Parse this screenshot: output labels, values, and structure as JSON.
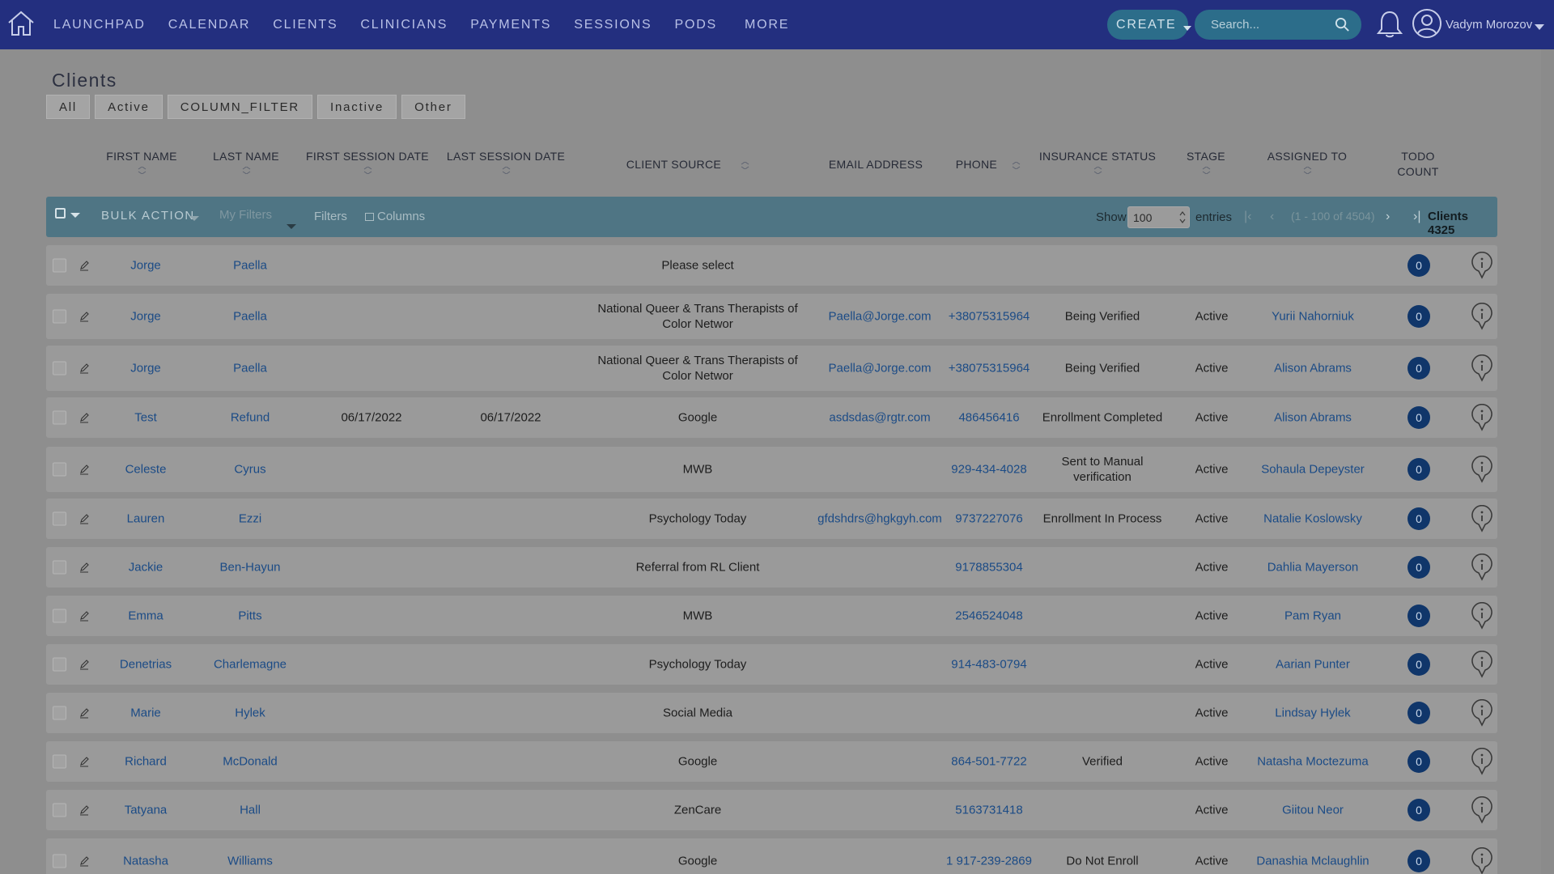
{
  "nav": {
    "items": [
      "LAUNCHPAD",
      "CALENDAR",
      "CLIENTS",
      "CLINICIANS",
      "PAYMENTS",
      "SESSIONS",
      "PODS",
      "MORE"
    ],
    "create_label": "CREATE",
    "search_placeholder": "Search...",
    "user_name": "Vadym Morozov"
  },
  "page": {
    "title": "Clients",
    "tabs": [
      "All",
      "Active",
      "COLUMN_FILTER",
      "Inactive",
      "Other"
    ]
  },
  "columns": {
    "first_name": "FIRST NAME",
    "last_name": "LAST NAME",
    "first_session": "FIRST SESSION DATE",
    "last_session": "LAST SESSION DATE",
    "client_source": "CLIENT SOURCE",
    "email": "EMAIL ADDRESS",
    "phone": "PHONE",
    "insurance": "INSURANCE STATUS",
    "stage": "STAGE",
    "assigned": "ASSIGNED TO",
    "todo_line1": "TODO",
    "todo_line2": "COUNT"
  },
  "toolbar": {
    "bulk_action": "BULK ACTION",
    "my_filters": "My Filters",
    "filters": "Filters",
    "columns": "Columns",
    "show": "Show",
    "show_value": "100",
    "entries": "entries",
    "page_info": "(1 - 100 of 4504)",
    "clients_count": "Clients 4325"
  },
  "rows": [
    {
      "first": "Jorge",
      "last": "Paella",
      "first_session": "",
      "last_session": "",
      "source": "Please select",
      "email": "",
      "phone": "",
      "insurance": "",
      "stage": "",
      "assigned": "",
      "todo": "0"
    },
    {
      "first": "Jorge",
      "last": "Paella",
      "first_session": "",
      "last_session": "",
      "source": "National Queer & Trans Therapists of Color Networ",
      "email": "Paella@Jorge.com",
      "phone": "+38075315964",
      "insurance": "Being Verified",
      "stage": "Active",
      "assigned": "Yurii Nahorniuk",
      "todo": "0"
    },
    {
      "first": "Jorge",
      "last": "Paella",
      "first_session": "",
      "last_session": "",
      "source": "National Queer & Trans Therapists of Color Networ",
      "email": "Paella@Jorge.com",
      "phone": "+38075315964",
      "insurance": "Being Verified",
      "stage": "Active",
      "assigned": "Alison Abrams",
      "todo": "0"
    },
    {
      "first": "Test",
      "last": "Refund",
      "first_session": "06/17/2022",
      "last_session": "06/17/2022",
      "source": "Google",
      "email": "asdsdas@rgtr.com",
      "phone": "486456416",
      "insurance": "Enrollment Completed",
      "stage": "Active",
      "assigned": "Alison Abrams",
      "todo": "0"
    },
    {
      "first": "Celeste",
      "last": "Cyrus",
      "first_session": "",
      "last_session": "",
      "source": "MWB",
      "email": "",
      "phone": "929-434-4028",
      "insurance": "Sent to Manual verification",
      "stage": "Active",
      "assigned": "Sohaula Depeyster",
      "todo": "0"
    },
    {
      "first": "Lauren",
      "last": "Ezzi",
      "first_session": "",
      "last_session": "",
      "source": "Psychology Today",
      "email": "gfdshdrs@hgkgyh.com",
      "phone": "9737227076",
      "insurance": "Enrollment In Process",
      "stage": "Active",
      "assigned": "Natalie Koslowsky",
      "todo": "0"
    },
    {
      "first": "Jackie",
      "last": "Ben-Hayun",
      "first_session": "",
      "last_session": "",
      "source": "Referral from RL Client",
      "email": "",
      "phone": "9178855304",
      "insurance": "",
      "stage": "Active",
      "assigned": "Dahlia Mayerson",
      "todo": "0"
    },
    {
      "first": "Emma",
      "last": "Pitts",
      "first_session": "",
      "last_session": "",
      "source": "MWB",
      "email": "",
      "phone": "2546524048",
      "insurance": "",
      "stage": "Active",
      "assigned": "Pam Ryan",
      "todo": "0"
    },
    {
      "first": "Denetrias",
      "last": "Charlemagne",
      "first_session": "",
      "last_session": "",
      "source": "Psychology Today",
      "email": "",
      "phone": "914-483-0794",
      "insurance": "",
      "stage": "Active",
      "assigned": "Aarian Punter",
      "todo": "0"
    },
    {
      "first": "Marie",
      "last": "Hylek",
      "first_session": "",
      "last_session": "",
      "source": "Social Media",
      "email": "",
      "phone": "",
      "insurance": "",
      "stage": "Active",
      "assigned": "Lindsay Hylek",
      "todo": "0"
    },
    {
      "first": "Richard",
      "last": "McDonald",
      "first_session": "",
      "last_session": "",
      "source": "Google",
      "email": "",
      "phone": "864-501-7722",
      "insurance": "Verified",
      "stage": "Active",
      "assigned": "Natasha Moctezuma",
      "todo": "0"
    },
    {
      "first": "Tatyana",
      "last": "Hall",
      "first_session": "",
      "last_session": "",
      "source": "ZenCare",
      "email": "",
      "phone": "5163731418",
      "insurance": "",
      "stage": "Active",
      "assigned": "Giitou Neor",
      "todo": "0"
    },
    {
      "first": "Natasha",
      "last": "Williams",
      "first_session": "",
      "last_session": "",
      "source": "Google",
      "email": "",
      "phone": "1 917-239-2869",
      "insurance": "Do Not Enroll",
      "stage": "Active",
      "assigned": "Danashia Mclaughlin",
      "todo": "0"
    }
  ]
}
